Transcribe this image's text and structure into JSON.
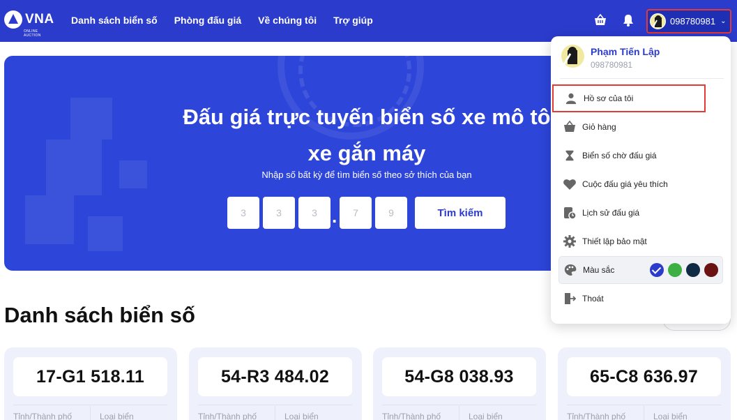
{
  "header": {
    "logo_text": "VNA",
    "logo_sub": "ONLINE AUCTION",
    "nav": [
      "Danh sách biển số",
      "Phòng đấu giá",
      "Về chúng tôi",
      "Trợ giúp"
    ],
    "user_phone": "098780981",
    "icons": [
      "basket-icon",
      "bell-icon",
      "chevron-down-icon"
    ]
  },
  "hero": {
    "title_line1": "Đấu giá trực tuyến biển số xe mô tô",
    "title_line2": "xe gắn máy",
    "subtitle": "Nhập số bất kỳ để tìm biển số theo sở thích của bạn",
    "digits": [
      "3",
      "3",
      "3",
      "7",
      "9"
    ],
    "search_label": "Tìm kiếm"
  },
  "list": {
    "title": "Danh sách biển số",
    "cards": [
      {
        "plate": "17-G1 518.11",
        "col1": "Tỉnh/Thành phố",
        "col2": "Loại biển"
      },
      {
        "plate": "54-R3 484.02",
        "col1": "Tỉnh/Thành phố",
        "col2": "Loại biển"
      },
      {
        "plate": "54-G8 038.93",
        "col1": "Tỉnh/Thành phố",
        "col2": "Loại biển"
      },
      {
        "plate": "65-C8 636.97",
        "col1": "Tỉnh/Thành phố",
        "col2": "Loại biển"
      }
    ]
  },
  "dropdown": {
    "name": "Phạm Tiến Lập",
    "phone": "098780981",
    "items": [
      {
        "label": "Hồ sơ của tôi",
        "icon": "user-icon"
      },
      {
        "label": "Giỏ hàng",
        "icon": "basket-icon"
      },
      {
        "label": "Biển số chờ đấu giá",
        "icon": "hourglass-icon"
      },
      {
        "label": "Cuộc đấu giá yêu thích",
        "icon": "heart-icon"
      },
      {
        "label": "Lịch sử đấu giá",
        "icon": "history-icon"
      },
      {
        "label": "Thiết lập bảo mật",
        "icon": "gear-icon"
      },
      {
        "label": "Màu sắc",
        "icon": "palette-icon"
      },
      {
        "label": "Thoát",
        "icon": "logout-icon"
      }
    ],
    "colors": [
      "#2b3bcc",
      "#3cb043",
      "#0f2a44",
      "#6b1212"
    ],
    "selected_color": "#2b3bcc"
  }
}
